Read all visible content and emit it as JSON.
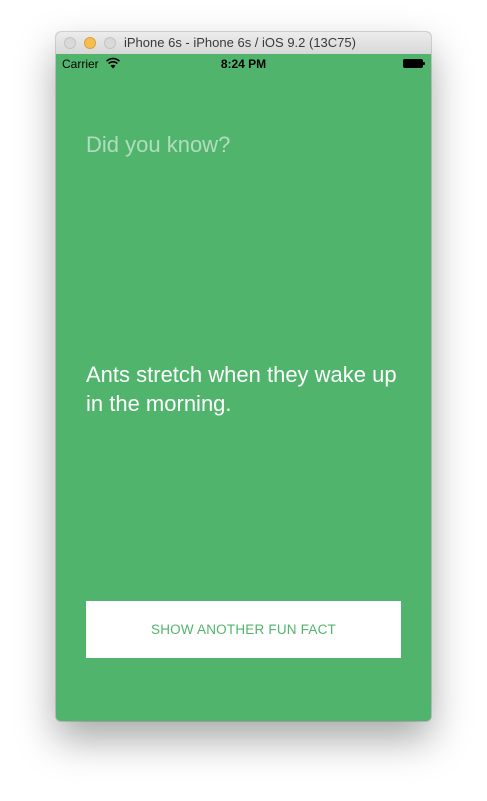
{
  "window": {
    "title": "iPhone 6s - iPhone 6s / iOS 9.2 (13C75)"
  },
  "statusbar": {
    "carrier": "Carrier",
    "time": "8:24 PM"
  },
  "content": {
    "heading": "Did you know?",
    "fact": "Ants stretch when they wake up in the morning.",
    "button_label": "SHOW ANOTHER FUN FACT"
  },
  "colors": {
    "background": "#51b46d",
    "button_text": "#51b46d",
    "button_background": "#ffffff"
  },
  "icons": {
    "wifi": "wifi-icon",
    "battery": "battery-icon"
  }
}
